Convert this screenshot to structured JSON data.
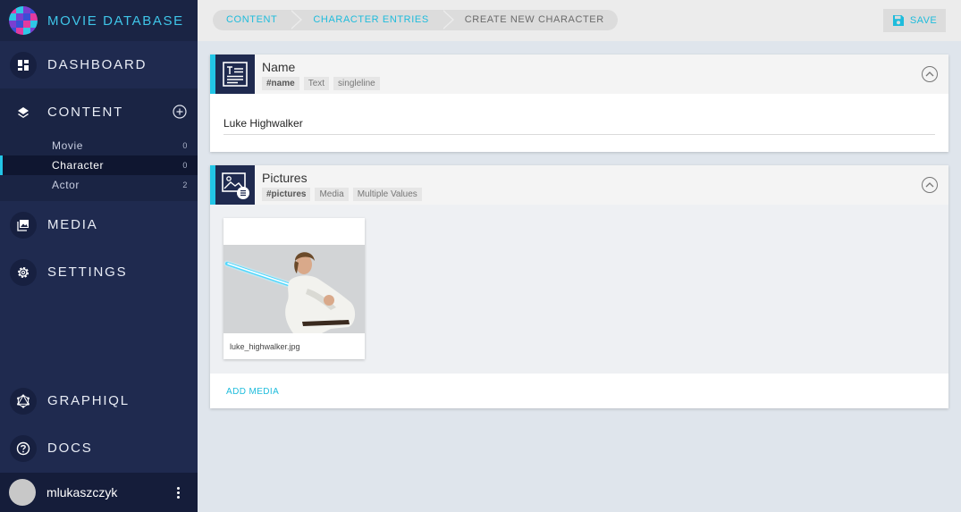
{
  "app": {
    "title": "MOVIE DATABASE"
  },
  "sidebar": {
    "dashboard": "DASHBOARD",
    "content": "CONTENT",
    "content_items": [
      {
        "label": "Movie",
        "count": "0"
      },
      {
        "label": "Character",
        "count": "0"
      },
      {
        "label": "Actor",
        "count": "2"
      }
    ],
    "media": "MEDIA",
    "settings": "SETTINGS",
    "graphiql": "GRAPHIQL",
    "docs": "DOCS",
    "user": "mlukaszczyk"
  },
  "breadcrumb": [
    "CONTENT",
    "CHARACTER ENTRIES",
    "CREATE NEW CHARACTER"
  ],
  "toolbar": {
    "save": "SAVE"
  },
  "fields": {
    "name": {
      "label": "Name",
      "tags": [
        "#name",
        "Text",
        "singleline"
      ],
      "value": "Luke Highwalker"
    },
    "pictures": {
      "label": "Pictures",
      "tags": [
        "#pictures",
        "Media",
        "Multiple Values"
      ],
      "files": [
        {
          "filename": "luke_highwalker.jpg"
        }
      ],
      "add_label": "ADD MEDIA"
    }
  },
  "colors": {
    "accent": "#22c5e6",
    "sidebar_bg": "#1f2a4f",
    "link": "#1ebcdc"
  },
  "icons": {
    "dashboard": "dashboard-icon",
    "content": "layers-icon",
    "media": "photo-library-icon",
    "settings": "gear-icon",
    "graphiql": "graphql-icon",
    "docs": "help-circle-icon",
    "save": "floppy-disk-icon",
    "collapse": "chevron-up-circle-icon"
  }
}
